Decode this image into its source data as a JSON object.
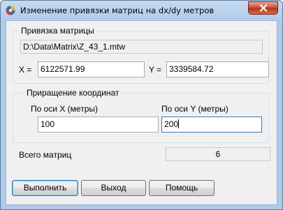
{
  "window": {
    "title": "Изменение привязки матриц на dx/dy метров"
  },
  "binding_group": {
    "title": "Привязка матрицы",
    "path": "D:\\Data\\Matrix\\Z_43_1.mtw",
    "x_label": "X =",
    "x_value": "6122571.99",
    "y_label": "Y =",
    "y_value": "3339584.72"
  },
  "increment_group": {
    "title": "Приращение координат",
    "x_axis_label": "По оси X (метры)",
    "x_axis_value": "100",
    "y_axis_label": "По оси Y (метры)",
    "y_axis_value": "200"
  },
  "total": {
    "label": "Всего матриц",
    "value": "6"
  },
  "buttons": {
    "execute": "Выполнить",
    "exit": "Выход",
    "help": "Помощь"
  },
  "colors": {
    "title_gradient_top": "#c6daf0",
    "close_button": "#c7472f",
    "client_bg": "#f0f0f0",
    "default_button_border": "#3c7fb1"
  }
}
